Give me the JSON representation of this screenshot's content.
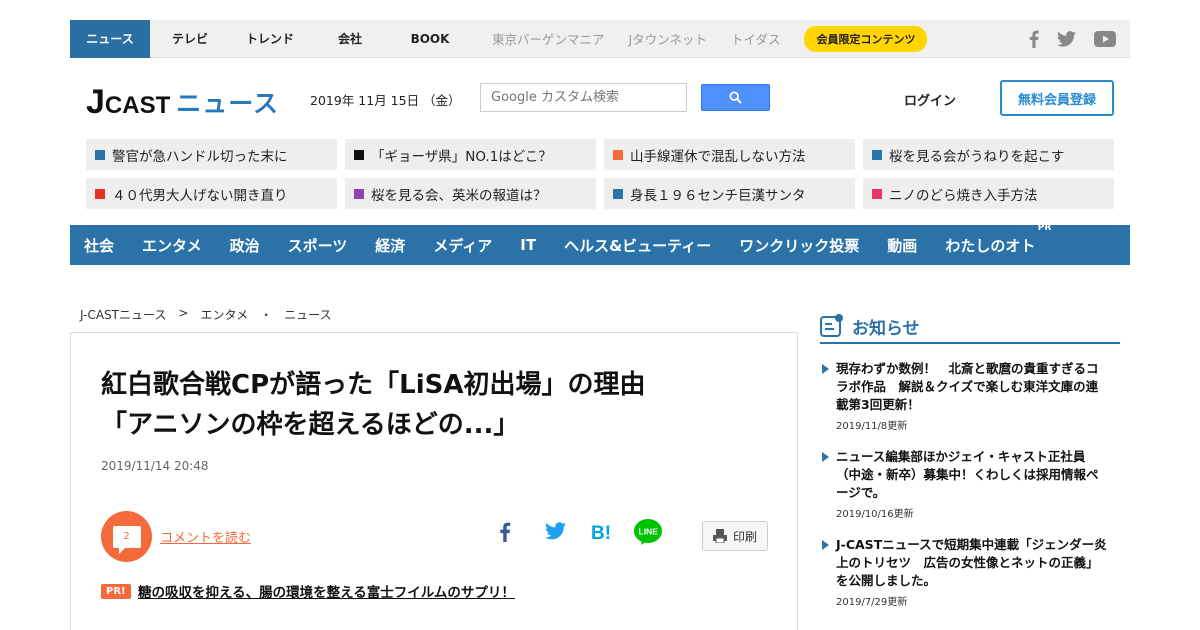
{
  "topbar": {
    "nav": [
      {
        "label": "ニュース",
        "active": true
      },
      {
        "label": "テレビ"
      },
      {
        "label": "トレンド"
      },
      {
        "label": "会社"
      },
      {
        "label": "BOOK"
      }
    ],
    "partners": [
      "東京バーゲンマニア",
      "Jタウンネット",
      "トイダス"
    ],
    "member_label": "会員限定コンテンツ",
    "social_icons": [
      "facebook-icon",
      "twitter-icon",
      "youtube-icon"
    ]
  },
  "header": {
    "logo_j": "J",
    "logo_cast": "CAST",
    "logo_news": "ニュース",
    "date": "2019年 11月 15日 （金）",
    "search_placeholder": "Google カスタム検索",
    "login": "ログイン",
    "register": "無料会員登録"
  },
  "headlines": [
    {
      "text": "警官が急ハンドル切った末に",
      "color": "#2a72a8"
    },
    {
      "text": "「ギョーザ県」NO.1はどこ？",
      "color": "#111111"
    },
    {
      "text": "山手線運休で混乱しない方法",
      "color": "#f46a3a"
    },
    {
      "text": "桜を見る会がうねりを起こす",
      "color": "#2a72a8"
    },
    {
      "text": "４０代男大人げない開き直り",
      "color": "#e53222"
    },
    {
      "text": "桜を見る会、英米の報道は？",
      "color": "#8e44ad"
    },
    {
      "text": "身長１９６センチ巨漢サンタ",
      "color": "#2a72a8"
    },
    {
      "text": "ニノのどら焼き入手方法",
      "color": "#e8336a"
    }
  ],
  "categories": [
    "社会",
    "エンタメ",
    "政治",
    "スポーツ",
    "経済",
    "メディア",
    "IT",
    "ヘルス&ビューティー",
    "ワンクリック投票",
    "動画",
    "わたしのオト"
  ],
  "category_pr": "PR",
  "breadcrumb": [
    "J-CASTニュース",
    ">",
    "エンタメ",
    "・",
    "ニュース"
  ],
  "article": {
    "title_line1": "紅白歌合戦CPが語った「LiSA初出場」の理由",
    "title_line2": "「アニソンの枠を超えるほどの...」",
    "date": "2019/11/14 20:48",
    "comment_count": "2",
    "comment_link": "コメントを読む",
    "print_label": "印刷",
    "pr_badge": "PR!",
    "pr_text": "糖の吸収を抑える、腸の環境を整える富士フイルムのサプリ！"
  },
  "sidebar": {
    "heading": "お知らせ",
    "items": [
      {
        "lines": [
          "現存わずか数例！　北斎と歌麿の貴重すぎるコ",
          "ラボ作品　解説＆クイズで楽しむ東洋文庫の連",
          "載第3回更新！"
        ],
        "updated": "2019/11/8更新"
      },
      {
        "lines": [
          "ニュース編集部ほかジェイ・キャスト正社員",
          "（中途・新卒）募集中！くわしくは採用情報ペ",
          "ージで。"
        ],
        "updated": "2019/10/16更新"
      },
      {
        "lines": [
          "J-CASTニュースで短期集中連載「ジェンダー炎",
          "上のトリセツ　広告の女性像とネットの正義」",
          "を公開しました。"
        ],
        "updated": "2019/7/29更新"
      }
    ]
  }
}
